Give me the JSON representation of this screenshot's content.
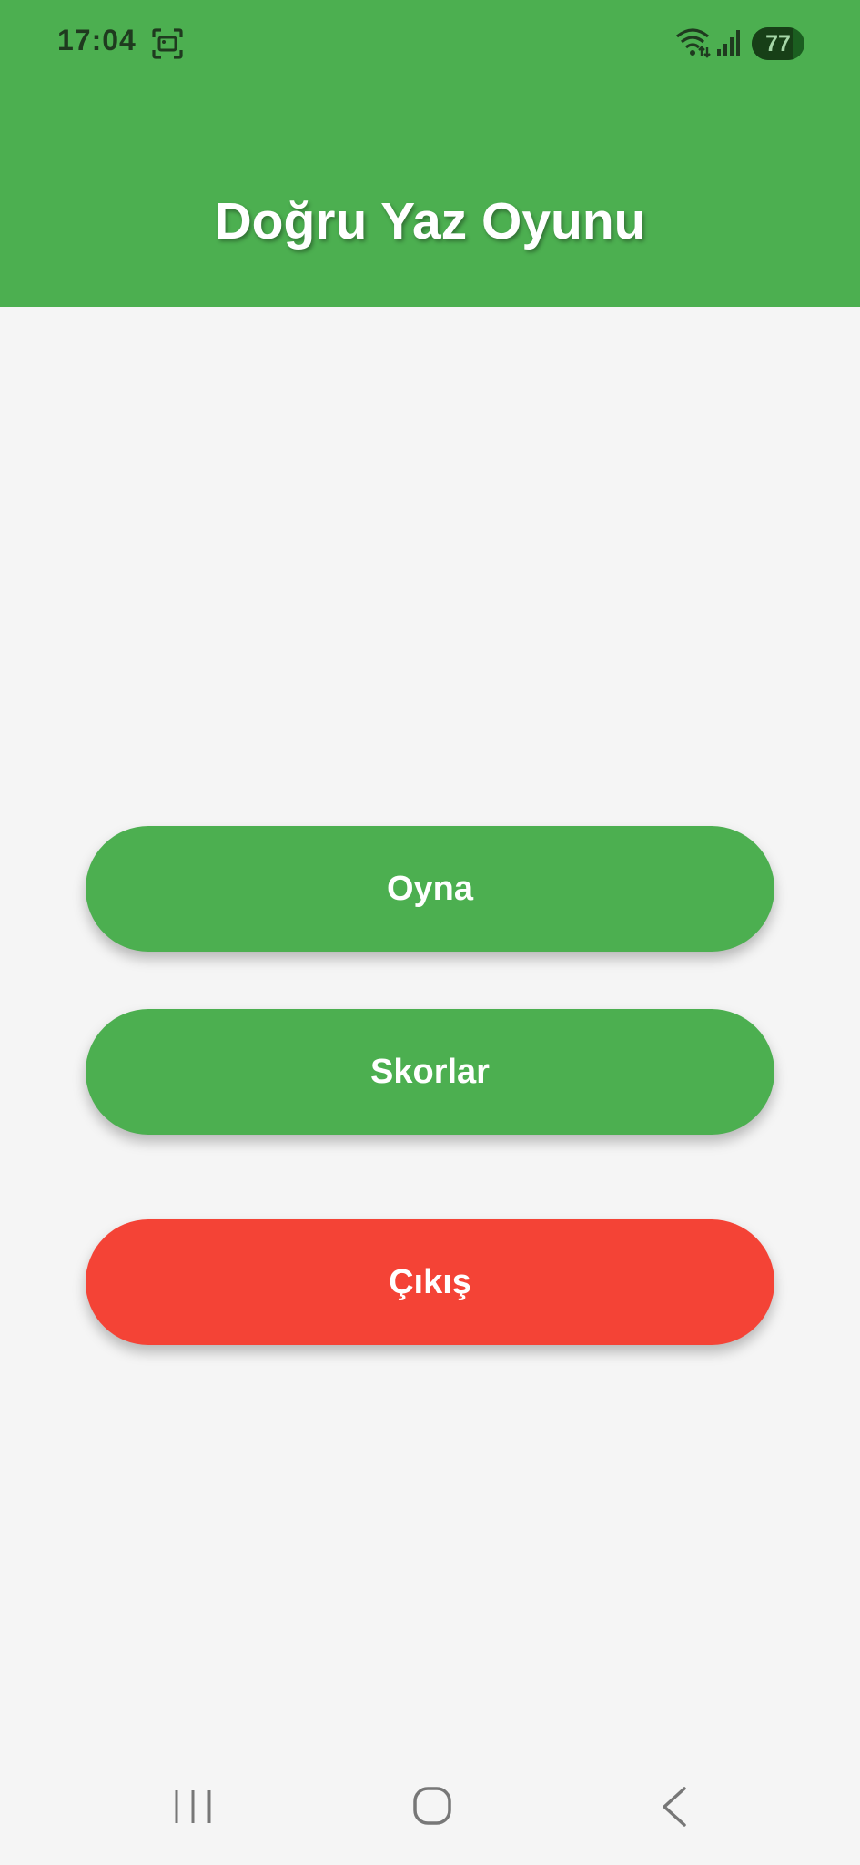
{
  "status_bar": {
    "time": "17:04",
    "battery_level": "77",
    "battery_fraction": 0.77,
    "icons": [
      "screenshot-icon",
      "wifi-icon",
      "signal-icon",
      "battery-icon"
    ]
  },
  "header": {
    "title": "Doğru Yaz Oyunu"
  },
  "menu": {
    "play_label": "Oyna",
    "scores_label": "Skorlar",
    "exit_label": "Çıkış"
  },
  "nav_bar": {
    "icons": [
      "recents-icon",
      "home-icon",
      "back-icon"
    ]
  },
  "colors": {
    "primary": "#4caf50",
    "danger": "#f44336",
    "background": "#f5f5f5",
    "text_on_primary": "#ffffff"
  }
}
